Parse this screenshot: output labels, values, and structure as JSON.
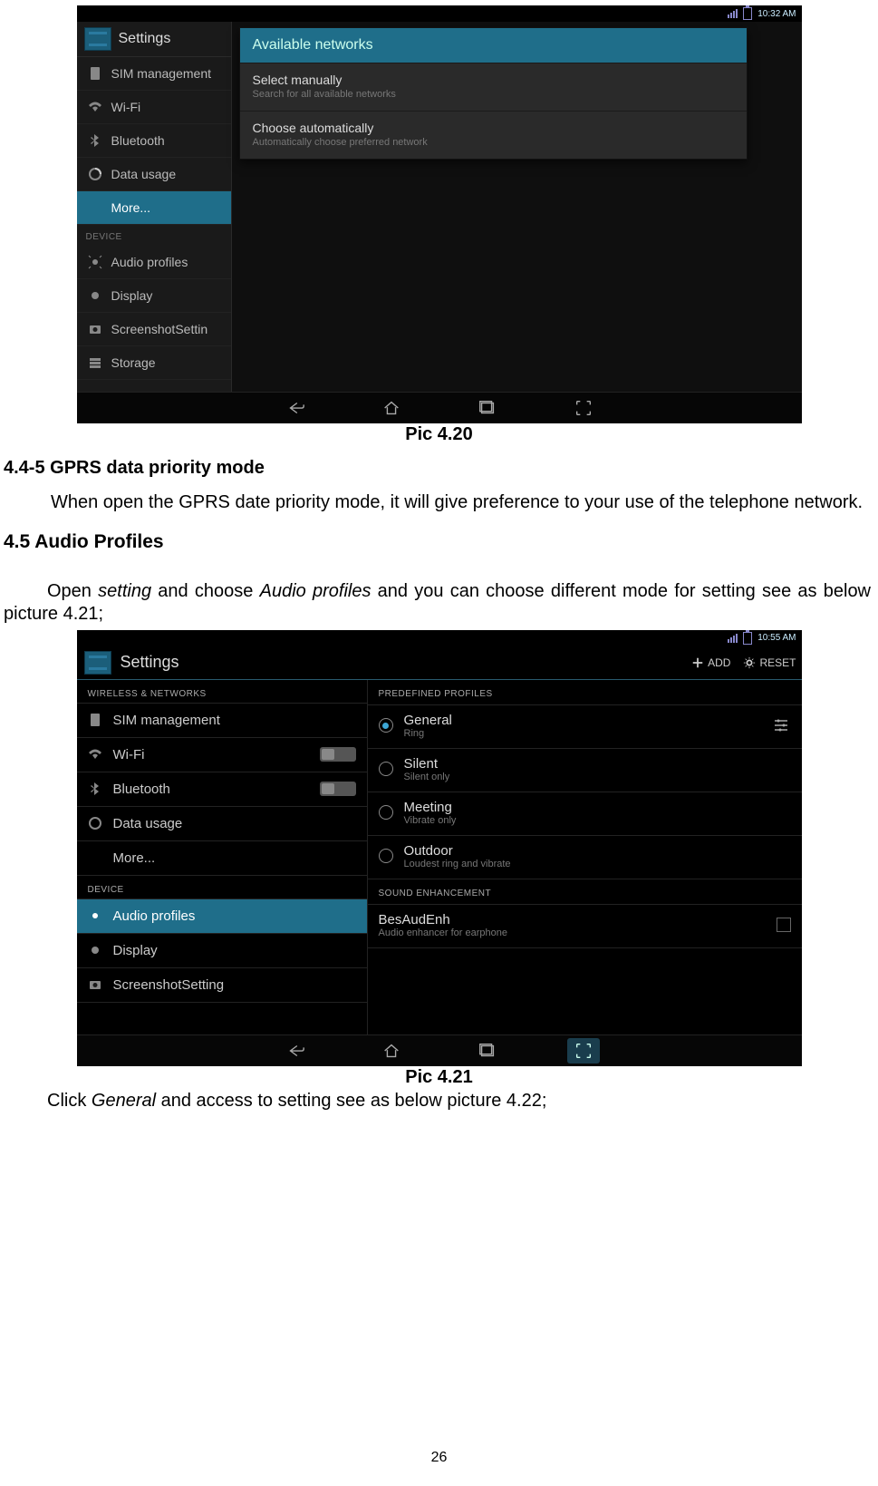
{
  "page_number": "26",
  "screenshot1": {
    "status_time": "10:32 AM",
    "settings_title": "Settings",
    "sidebar_items": [
      "SIM management",
      "Wi-Fi",
      "Bluetooth",
      "Data usage",
      "More...",
      "Audio profiles",
      "Display",
      "ScreenshotSettin",
      "Storage"
    ],
    "device_header": "DEVICE",
    "popup": {
      "title": "Available networks",
      "rows": [
        {
          "title": "Select manually",
          "sub": "Search for all available networks"
        },
        {
          "title": "Choose automatically",
          "sub": "Automatically choose preferred network"
        }
      ]
    }
  },
  "caption1": "Pic 4.20",
  "heading_445": "4.4-5 GPRS data priority mode",
  "para_445": "When open the GPRS date priority mode, it will give preference to your use of the telephone network.",
  "heading_45": "4.5 Audio Profiles",
  "para_45_pre": "Open ",
  "para_45_it1": "setting",
  "para_45_mid": " and choose ",
  "para_45_it2": "Audio profiles",
  "para_45_post": " and you can choose different mode for setting see as below picture 4.21;",
  "screenshot2": {
    "status_time": "10:55 AM",
    "settings_title": "Settings",
    "add_label": "ADD",
    "reset_label": "RESET",
    "left_sec1": "WIRELESS & NETWORKS",
    "left_items": [
      {
        "label": "SIM management",
        "toggle": null
      },
      {
        "label": "Wi-Fi",
        "toggle": "off"
      },
      {
        "label": "Bluetooth",
        "toggle": "off"
      },
      {
        "label": "Data usage",
        "toggle": null
      },
      {
        "label": "More...",
        "toggle": null
      }
    ],
    "left_sec2": "DEVICE",
    "left_items2": [
      {
        "label": "Audio profiles"
      },
      {
        "label": "Display"
      },
      {
        "label": "ScreenshotSetting"
      }
    ],
    "right_sec1": "PREDEFINED PROFILES",
    "profiles": [
      {
        "title": "General",
        "sub": "Ring",
        "selected": true,
        "sliders": true
      },
      {
        "title": "Silent",
        "sub": "Silent only",
        "selected": false
      },
      {
        "title": "Meeting",
        "sub": "Vibrate only",
        "selected": false
      },
      {
        "title": "Outdoor",
        "sub": "Loudest ring and vibrate",
        "selected": false
      }
    ],
    "right_sec2": "SOUND ENHANCEMENT",
    "enhancement": {
      "title": "BesAudEnh",
      "sub": "Audio enhancer for earphone"
    }
  },
  "caption2": "Pic 4.21",
  "para_after2_pre": "Click ",
  "para_after2_it": "General",
  "para_after2_post": " and access to setting see as below picture 4.22;"
}
